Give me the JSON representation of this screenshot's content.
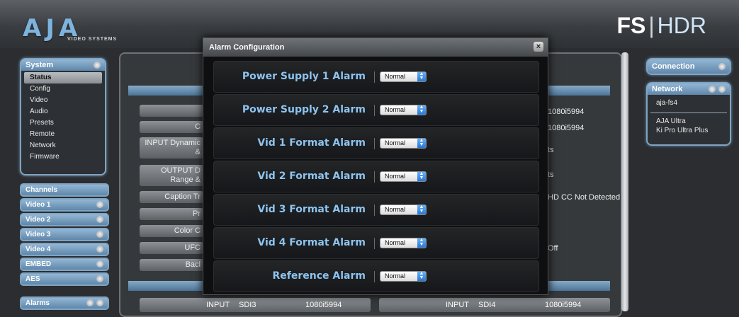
{
  "brand": {
    "logo": "AJA",
    "logo_sub": "VIDEO SYSTEMS",
    "product_fs": "FS",
    "product_sep": "|",
    "product_hdr": "HDR"
  },
  "system_panel": {
    "title": "System",
    "items": [
      "Status",
      "Config",
      "Video",
      "Audio",
      "Presets",
      "Remote",
      "Network",
      "Firmware"
    ]
  },
  "channels": {
    "title": "Channels",
    "items": [
      "Video 1",
      "Video 2",
      "Video 3",
      "Video 4",
      "EMBED",
      "AES"
    ]
  },
  "alarms_panel": {
    "title": "Alarms"
  },
  "connection_panel": {
    "title": "Connection"
  },
  "network_panel": {
    "title": "Network",
    "items": [
      "aja-fs4",
      "AJA Ultra",
      "Ki Pro Ultra Plus"
    ]
  },
  "background": {
    "left_buttons": [
      "C",
      "INPUT Dynamic &",
      "OUTPUT D Range &",
      "Caption Tr",
      "Pr",
      "Color C",
      "UFC",
      "Bacl"
    ],
    "right_values": [
      "1080i5994",
      "1080i5994",
      "ts",
      "ts",
      "HD CC Not Detected",
      "Off"
    ],
    "bottom_left": {
      "label": "INPUT",
      "port": "SDI3",
      "format": "1080i5994"
    },
    "bottom_right": {
      "label": "INPUT",
      "port": "SDI4",
      "format": "1080i5994"
    }
  },
  "modal": {
    "title": "Alarm Configuration",
    "close": "×",
    "rows": [
      {
        "label": "Power Supply 1 Alarm",
        "value": "Normal"
      },
      {
        "label": "Power Supply 2 Alarm",
        "value": "Normal"
      },
      {
        "label": "Vid 1 Format Alarm",
        "value": "Normal"
      },
      {
        "label": "Vid 2 Format Alarm",
        "value": "Normal"
      },
      {
        "label": "Vid 3 Format Alarm",
        "value": "Normal"
      },
      {
        "label": "Vid 4 Format Alarm",
        "value": "Normal"
      },
      {
        "label": "Reference Alarm",
        "value": "Normal"
      }
    ]
  }
}
